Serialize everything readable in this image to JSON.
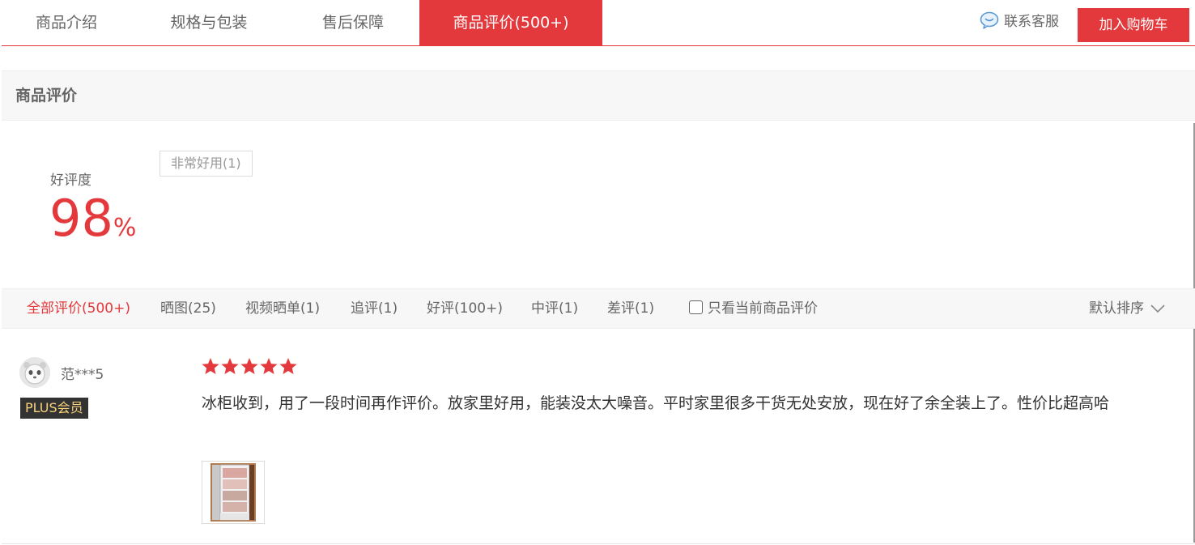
{
  "tabs": [
    {
      "label": "商品介绍",
      "active": false
    },
    {
      "label": "规格与包装",
      "active": false
    },
    {
      "label": "售后保障",
      "active": false
    },
    {
      "label": "商品评价(500+)",
      "active": true
    }
  ],
  "service": {
    "label": "联系客服",
    "icon": "chat-bubble-icon"
  },
  "cart_button": "加入购物车",
  "section_title": "商品评价",
  "rating": {
    "label": "好评度",
    "value": "98",
    "unit": "%"
  },
  "tags": [
    "非常好用(1)"
  ],
  "filters": [
    {
      "label": "全部评价(500+)",
      "active": true
    },
    {
      "label": "晒图(25)",
      "active": false
    },
    {
      "label": "视频晒单(1)",
      "active": false
    },
    {
      "label": "追评(1)",
      "active": false
    },
    {
      "label": "好评(100+)",
      "active": false
    },
    {
      "label": "中评(1)",
      "active": false
    },
    {
      "label": "差评(1)",
      "active": false
    }
  ],
  "only_current_label": "只看当前商品评价",
  "sort_label": "默认排序",
  "review": {
    "username": "范***5",
    "badge": "PLUS会员",
    "stars": 5,
    "content": "冰柜收到，用了一段时间再作评价。放家里好用，能装没太大噪音。平时家里很多干货无处安放，现在好了余全装上了。性价比超高哈"
  },
  "colors": {
    "accent": "#e4393c",
    "plus_text": "#f7d07a"
  }
}
